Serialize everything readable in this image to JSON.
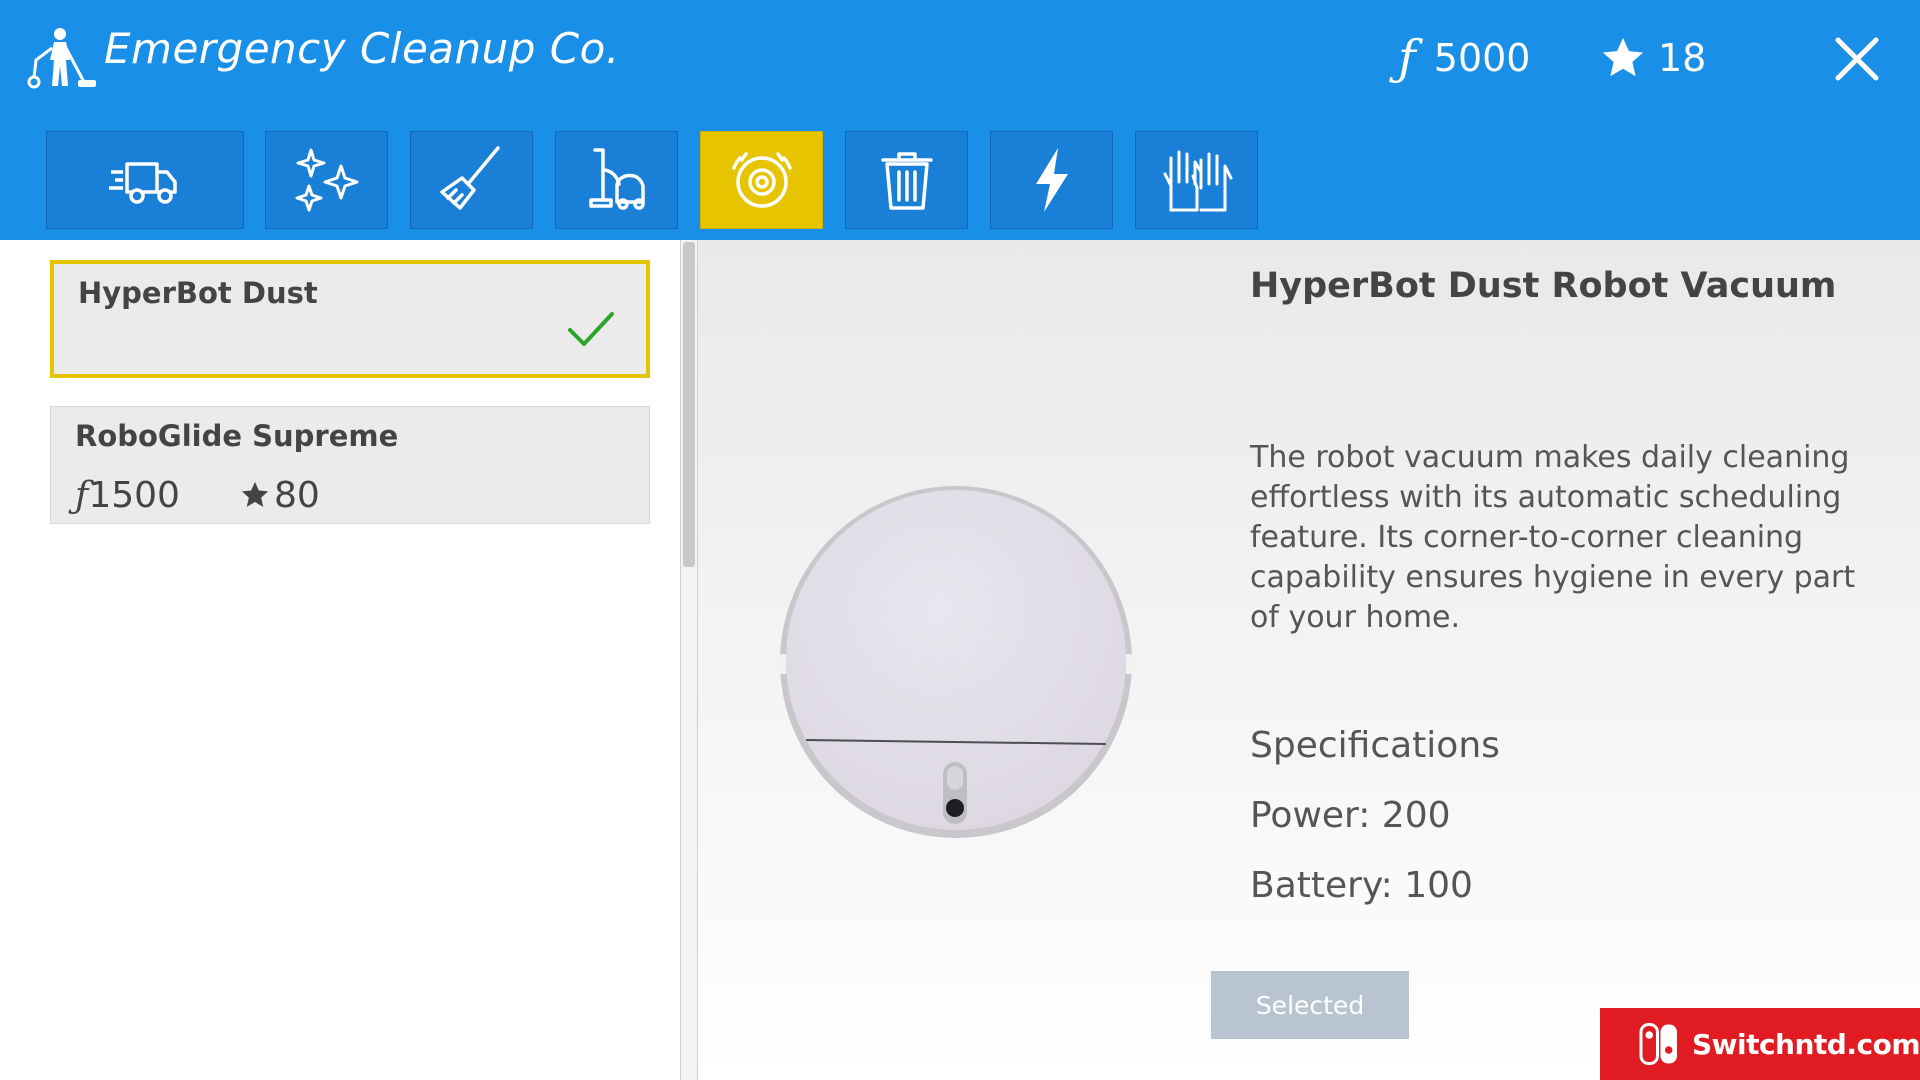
{
  "header": {
    "title": "Emergency Cleanup Co.",
    "logo_icon": "janitor-vacuum-icon",
    "currency_symbol": "ƒ",
    "currency_amount": "5000",
    "rating_amount": "18",
    "close_icon": "close-icon"
  },
  "toolbar": {
    "active_tab": "robot-vacuum",
    "tabs": [
      {
        "icon": "delivery-truck-icon"
      },
      {
        "icon": "sparkles-icon"
      },
      {
        "icon": "mop-icon"
      },
      {
        "icon": "vacuum-cleaner-icon"
      },
      {
        "icon": "robot-vacuum-icon"
      },
      {
        "icon": "trash-can-icon"
      },
      {
        "icon": "lightning-icon"
      },
      {
        "icon": "gloves-icon"
      }
    ]
  },
  "list": {
    "items": [
      {
        "name": "HyperBot Dust",
        "selected": true,
        "status_icon": "checkmark-icon"
      },
      {
        "name": "RoboGlide Supreme",
        "price_symbol": "ƒ",
        "price": "1500",
        "rating": "80"
      }
    ]
  },
  "detail": {
    "title": "HyperBot Dust Robot Vacuum",
    "description": "The robot vacuum makes daily cleaning effortless with its automatic scheduling feature. Its corner-to-corner cleaning capability ensures hygiene in every part of your home.",
    "spec_heading": "Specifications",
    "power": "Power: 200",
    "battery": "Battery: 100",
    "button_label": "Selected"
  },
  "watermark": {
    "text": "Switchntd.com"
  },
  "colors": {
    "header_blue": "#1a8fe8",
    "button_blue": "#1a7fd6",
    "active_yellow": "#e6c400",
    "check_green": "#2aa52a",
    "selected_button": "#b9c4d1",
    "watermark_red": "#e01b22"
  }
}
